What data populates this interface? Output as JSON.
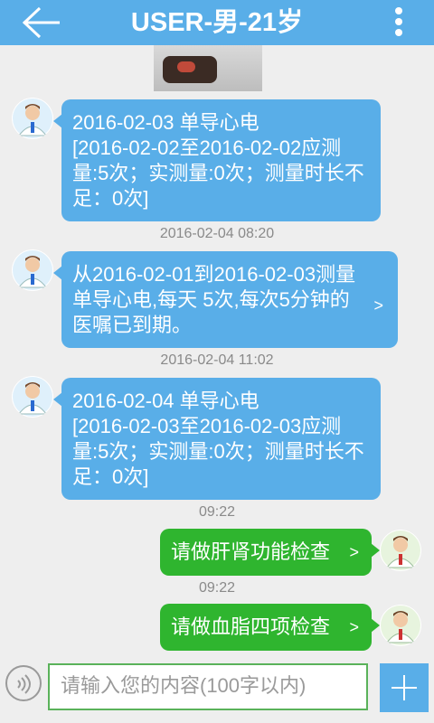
{
  "header": {
    "title": "USER-男-21岁",
    "back_icon": "back-arrow-icon",
    "menu_icon": "more-vertical-icon"
  },
  "messages": [
    {
      "side": "left",
      "text": "2016-02-03 单导心电\n[2016-02-02至2016-02-02应测量:5次；实测量:0次；测量时长不足：0次]"
    },
    {
      "time": "2016-02-04 08:20"
    },
    {
      "side": "left",
      "text": "从2016-02-01到2016-02-03测量单导心电,每天 5次,每次5分钟的医嘱已到期。",
      "chevron": ">"
    },
    {
      "time": "2016-02-04 11:02"
    },
    {
      "side": "left",
      "text": " 2016-02-04 单导心电\n[2016-02-03至2016-02-03应测量:5次；实测量:0次；测量时长不足：0次]"
    },
    {
      "time": "09:22"
    },
    {
      "side": "right",
      "text": "请做肝肾功能检查",
      "chevron": ">"
    },
    {
      "time": "09:22"
    },
    {
      "side": "right",
      "text": "请做血脂四项检查",
      "chevron": ">"
    }
  ],
  "input": {
    "placeholder": "请输入您的内容(100字以内)",
    "value": ""
  },
  "colors": {
    "header": "#59aee8",
    "bubble_left": "#59aee8",
    "bubble_right": "#2fb52f",
    "background": "#eeeeee"
  }
}
